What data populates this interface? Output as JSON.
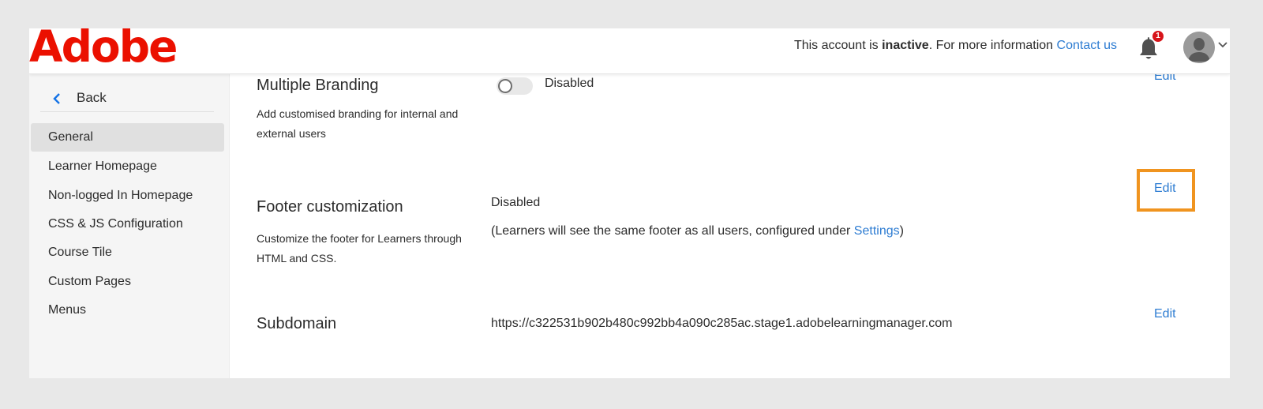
{
  "header": {
    "logo_text": "Adobe",
    "account_msg_prefix": "This account is ",
    "account_msg_status": "inactive",
    "account_msg_suffix": ". For more information ",
    "contact_link": "Contact us",
    "notification_count": "1",
    "icons": {
      "notifications": "bell-icon",
      "avatar": "user-avatar-icon",
      "menu": "chevron-down-icon"
    }
  },
  "sidebar": {
    "back_label": "Back",
    "items": [
      {
        "label": "General",
        "active": true
      },
      {
        "label": "Learner Homepage",
        "active": false
      },
      {
        "label": "Non-logged In Homepage",
        "active": false
      },
      {
        "label": "CSS & JS Configuration",
        "active": false
      },
      {
        "label": "Course Tile",
        "active": false
      },
      {
        "label": "Custom Pages",
        "active": false
      },
      {
        "label": "Menus",
        "active": false
      }
    ]
  },
  "sections": {
    "multiple_branding": {
      "title": "Multiple Branding",
      "description": "Add customised branding for internal and external users",
      "toggle_state": "Disabled",
      "edit_label": "Edit"
    },
    "footer": {
      "title": "Footer customization",
      "description": "Customize the footer for Learners through HTML and CSS.",
      "status": "Disabled",
      "note_prefix": "(Learners will see the same footer as all users, configured under ",
      "note_link": "Settings",
      "note_suffix": ")",
      "edit_label": "Edit"
    },
    "subdomain": {
      "title": "Subdomain",
      "value": "https://c322531b902b480c992bb4a090c285ac.stage1.adobelearningmanager.com",
      "edit_label": "Edit"
    }
  },
  "colors": {
    "brand": "#eb1000",
    "link": "#2d7cd2",
    "highlight": "#f0941f",
    "badge": "#d7141a"
  }
}
